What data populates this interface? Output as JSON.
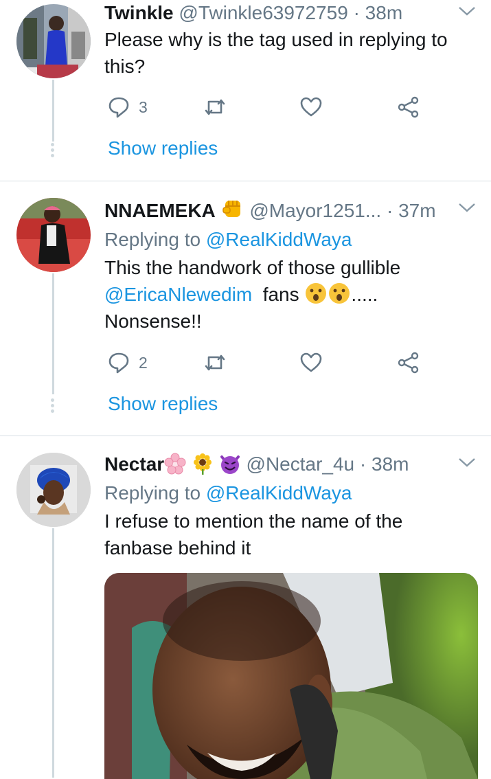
{
  "tweets": [
    {
      "name": "Twinkle",
      "handle": "@Twinkle63972759",
      "dot": "·",
      "time": "38m",
      "text": "Please why is the tag used in replying to this?",
      "reply_count": "3",
      "show_replies": "Show replies"
    },
    {
      "name": "NNAEMEKA",
      "handle": "@Mayor1251...",
      "dot": "·",
      "time": "37m",
      "replying_prefix": "Replying to",
      "replying_to": "@RealKiddWaya",
      "text_line1": "This the handwork of those gullible",
      "mention": "@EricaNlewedim",
      "text_fans": "fans",
      "text_dots": ".....",
      "text_line3": "Nonsense!!",
      "reply_count": "2",
      "show_replies": "Show replies"
    },
    {
      "name": "Nectar",
      "handle": "@Nectar_4u",
      "dot": "·",
      "time": "38m",
      "replying_prefix": "Replying to",
      "replying_to": "@RealKiddWaya",
      "text": "I refuse to mention the name of the fanbase behind it"
    }
  ],
  "colors": {
    "link": "#1b95e0",
    "muted": "#657786",
    "divider": "#d6dde3"
  },
  "icons": [
    "reply-icon",
    "retweet-icon",
    "like-icon",
    "share-icon",
    "chevron-down-icon"
  ]
}
